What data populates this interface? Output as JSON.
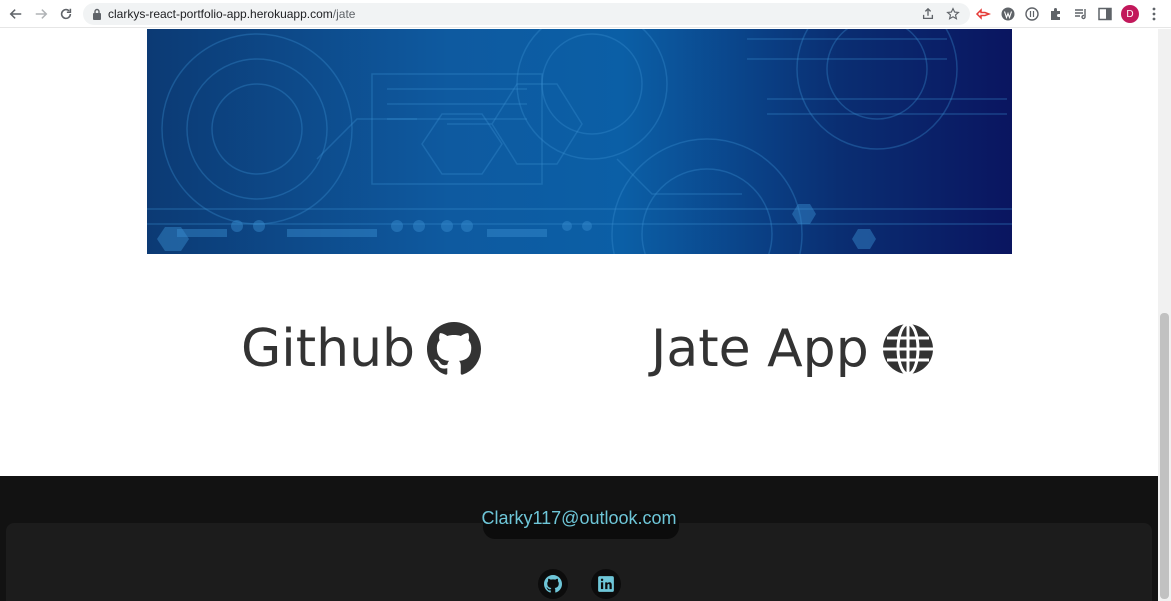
{
  "browser": {
    "url_host": "clarkys-react-portfolio-app.herokuapp.com",
    "url_path": "/jate",
    "profile_initial": "D",
    "colors": {
      "profile": "#c2185b",
      "extension_red": "#e53935"
    }
  },
  "project": {
    "github_label": "Github",
    "app_label": "Jate App",
    "text_color": "#333333"
  },
  "footer": {
    "email": "Clarky117@outlook.com",
    "email_color": "#6ec6d8",
    "background": "#121212",
    "social_icons": [
      "github-icon",
      "linkedin-icon"
    ]
  }
}
